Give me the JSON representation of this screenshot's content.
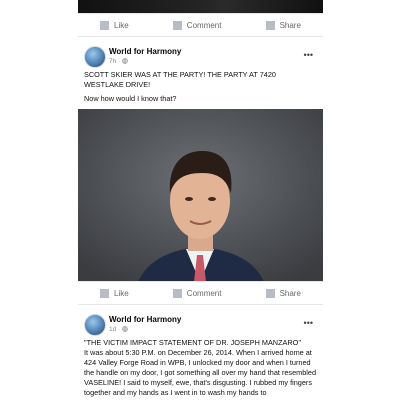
{
  "actions": {
    "like": "Like",
    "comment": "Comment",
    "share": "Share"
  },
  "posts": [
    {
      "author": "World for Harmony",
      "time": "7h · ",
      "privacy_icon": "globe-icon",
      "text1": "SCOTT SKIER WAS AT THE PARTY! THE PARTY AT 7420 WESTLAKE DRIVE!",
      "text2": "Now how would I know that?"
    },
    {
      "author": "World for Harmony",
      "time": "1d · ",
      "privacy_icon": "globe-icon",
      "text1": "\"THE VICTIM IMPACT STATEMENT OF DR. JOSEPH MANZARO\"",
      "text2": "It was about 5:30 P.M. on December 26, 2014. When I arrived home at 424 Valley Forge Road in WPB, I unlocked my door and when I turned the handle on my door, I got something all over my hand that resembled VASELINE! I said to myself, ewe, that's disgusting. I rubbed my fingers together and my hands as I went in to wash my hands to"
    }
  ],
  "colors": {
    "action_gray": "#65676b",
    "icon_gray": "#b8bdc5",
    "meta_gray": "#8a8d91"
  }
}
